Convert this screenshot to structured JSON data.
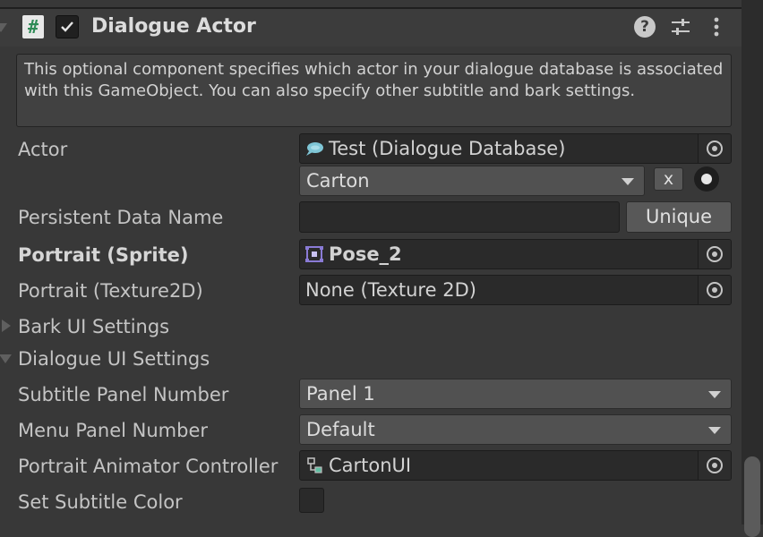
{
  "component": {
    "title": "Dialogue Actor",
    "description": "This optional component specifies which actor in your dialogue database is associated with this GameObject. You can also specify other subtitle and bark settings.",
    "enabled": true,
    "icons": [
      "chevron-down-icon",
      "script-icon",
      "checkmark-icon",
      "help-icon",
      "settings-sliders-icon",
      "kebab-menu-icon"
    ]
  },
  "fields": {
    "actor": {
      "label": "Actor",
      "database_value": "Test (Dialogue Database)",
      "dropdown_value": "Carton",
      "clear_label": "x"
    },
    "persistent": {
      "label": "Persistent Data Name",
      "value": "",
      "button_label": "Unique"
    },
    "portrait_sprite": {
      "label": "Portrait (Sprite)",
      "value": "Pose_2"
    },
    "portrait_texture": {
      "label": "Portrait (Texture2D)",
      "value": "None (Texture 2D)"
    },
    "bark_ui": {
      "label": "Bark UI Settings"
    },
    "dialogue_ui": {
      "label": "Dialogue UI Settings"
    },
    "subtitle_panel": {
      "label": "Subtitle Panel Number",
      "value": "Panel 1"
    },
    "menu_panel": {
      "label": "Menu Panel Number",
      "value": "Default"
    },
    "animator": {
      "label": "Portrait Animator Controller",
      "value": "CartonUI"
    },
    "subtitle_color": {
      "label": "Set Subtitle Color",
      "checked": false
    }
  },
  "colors": {
    "background": "#383838",
    "field_bg": "#2a2a2a",
    "text": "#c4c4c4",
    "script_icon_green": "#2e8b57",
    "sprite_icon_purple": "#8a7bd6"
  }
}
